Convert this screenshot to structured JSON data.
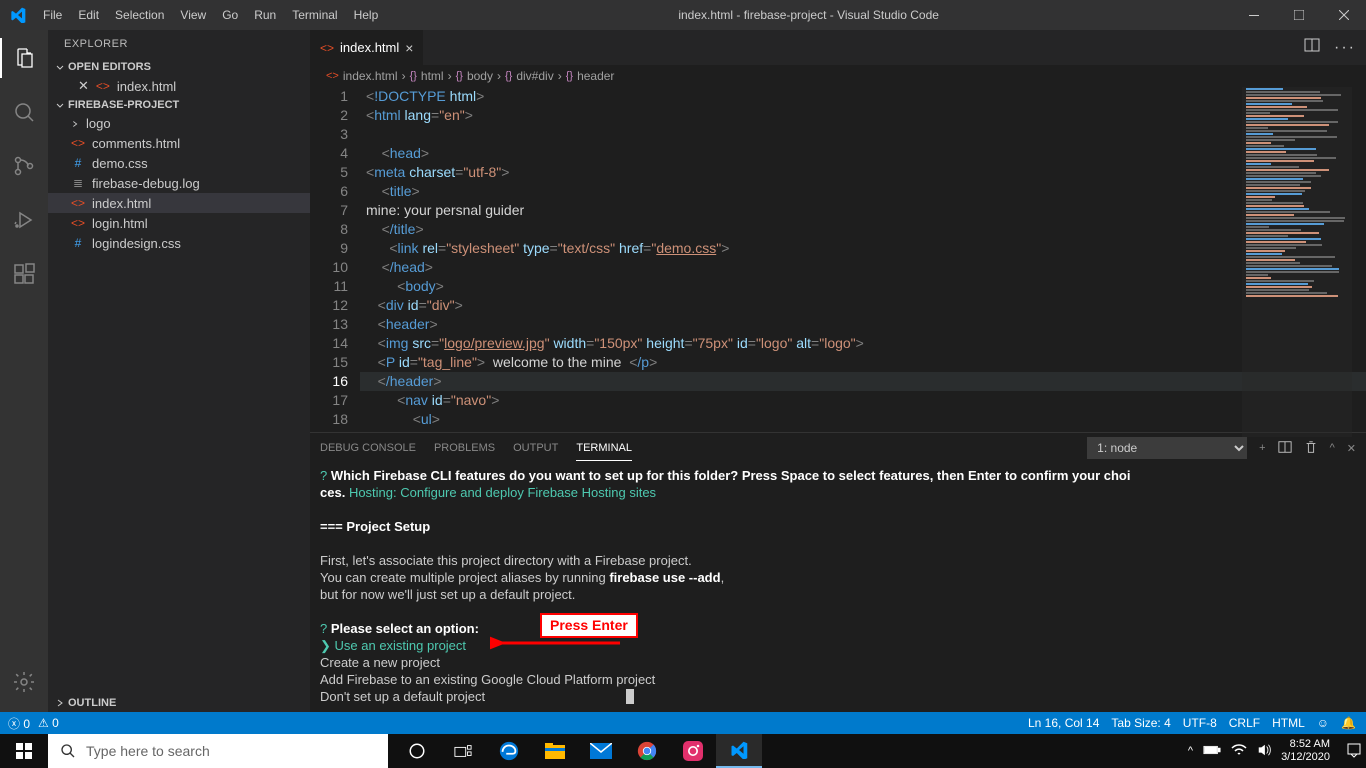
{
  "titlebar": {
    "menu": [
      "File",
      "Edit",
      "Selection",
      "View",
      "Go",
      "Run",
      "Terminal",
      "Help"
    ],
    "title": "index.html - firebase-project - Visual Studio Code"
  },
  "sidebar": {
    "header": "EXPLORER",
    "sections": {
      "open_editors": "OPEN EDITORS",
      "project": "FIREBASE-PROJECT",
      "outline": "OUTLINE"
    },
    "open_file": "index.html",
    "tree": {
      "folder": "logo",
      "files": [
        "comments.html",
        "demo.css",
        "firebase-debug.log",
        "index.html",
        "login.html",
        "logindesign.css"
      ]
    }
  },
  "tab": {
    "label": "index.html"
  },
  "breadcrumbs": [
    "index.html",
    "html",
    "body",
    "div#div",
    "header"
  ],
  "code": {
    "lines": [
      "<!DOCTYPE html>",
      "<html lang=\"en\">",
      "",
      "    <head>",
      "<meta charset=\"utf-8\">",
      "    <title>",
      "mine: your persnal guider",
      "    </title>",
      "      <link rel=\"stylesheet\" type=\"text/css\" href=\"demo.css\">",
      "    </head>",
      "        <body>",
      "   <div id=\"div\">",
      "   <header>",
      "   <img src=\"logo/preview.jpg\" width=\"150px\" height=\"75px\" id=\"logo\" alt=\"logo\">",
      "   <P id=\"tag_line\">  welcome to the mine  </p>",
      "   </header>",
      "        <nav id=\"navo\">",
      "            <ul>"
    ]
  },
  "panel": {
    "tabs": [
      "DEBUG CONSOLE",
      "PROBLEMS",
      "OUTPUT",
      "TERMINAL"
    ],
    "dropdown": "1: node",
    "terminal": {
      "q1a": "Which Firebase CLI features do you want to set up for this folder? Press Space to select features, then Enter to confirm your choi",
      "q1b": "ces.",
      "q1c": "Hosting: Configure and deploy Firebase Hosting sites",
      "setup": "=== Project Setup",
      "p1": "First, let's associate this project directory with a Firebase project.",
      "p2a": "You can create multiple project aliases by running ",
      "p2b": "firebase use --add",
      "p2c": ",",
      "p3": "but for now we'll just set up a default project.",
      "q2": "Please select an option:",
      "opt1": "Use an existing project",
      "opt2": "  Create a new project",
      "opt3": "  Add Firebase to an existing Google Cloud Platform project",
      "opt4": "  Don't set up a default project"
    }
  },
  "annotation": {
    "label": "Press Enter"
  },
  "status": {
    "errors": "0",
    "warnings": "0",
    "cursor": "Ln 16, Col 14",
    "tabsize": "Tab Size: 4",
    "encoding": "UTF-8",
    "eol": "CRLF",
    "lang": "HTML"
  },
  "taskbar": {
    "search_placeholder": "Type here to search",
    "time": "8:52 AM",
    "date": "3/12/2020"
  }
}
